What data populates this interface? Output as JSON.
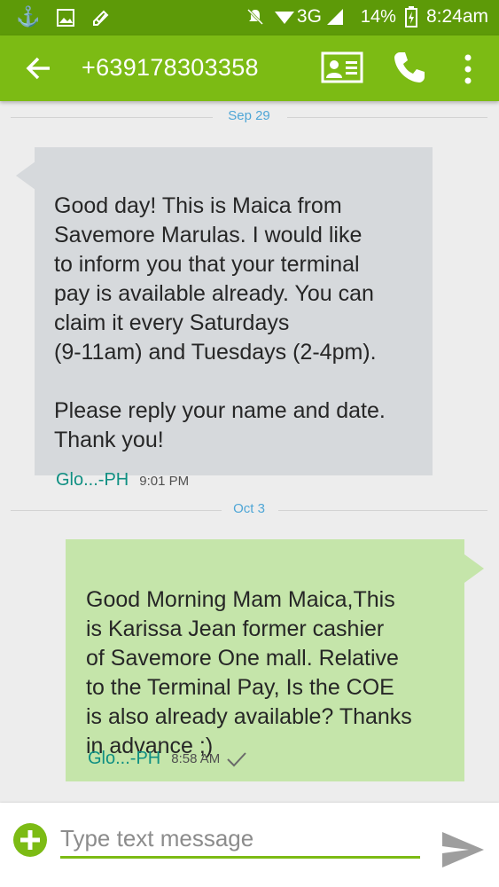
{
  "status_bar": {
    "network": "3G",
    "battery": "14%",
    "time": "8:24am"
  },
  "header": {
    "title": "+639178303358"
  },
  "conversation": [
    {
      "date": "Sep 29",
      "direction": "incoming",
      "text": "Good day! This is Maica from\nSavemore Marulas. I would like\nto inform you that your terminal\npay is available already. You can\nclaim it every Saturdays\n(9-11am) and Tuesdays (2-4pm).\n\nPlease reply your name and date.\nThank you!",
      "sim": "Glo...-PH",
      "time": "9:01 PM"
    },
    {
      "date": "Oct 3",
      "direction": "outgoing",
      "text": "Good Morning Mam Maica,This\nis Karissa Jean former cashier\nof Savemore One mall.  Relative\nto the Terminal Pay,  Is the COE\nis also already available? Thanks\nin advance ;)",
      "sim": "Glo...-PH",
      "time": "8:58 AM",
      "delivered_icon": "check-icon"
    }
  ],
  "composer": {
    "placeholder": "Type text message"
  },
  "colors": {
    "status_bar": "#5d9a08",
    "app_bar": "#7cbb14",
    "incoming_bubble": "#d6d9dc",
    "outgoing_bubble": "#c5e5aa",
    "date_label": "#4fa6d6",
    "sim_label": "#0f8f82"
  }
}
